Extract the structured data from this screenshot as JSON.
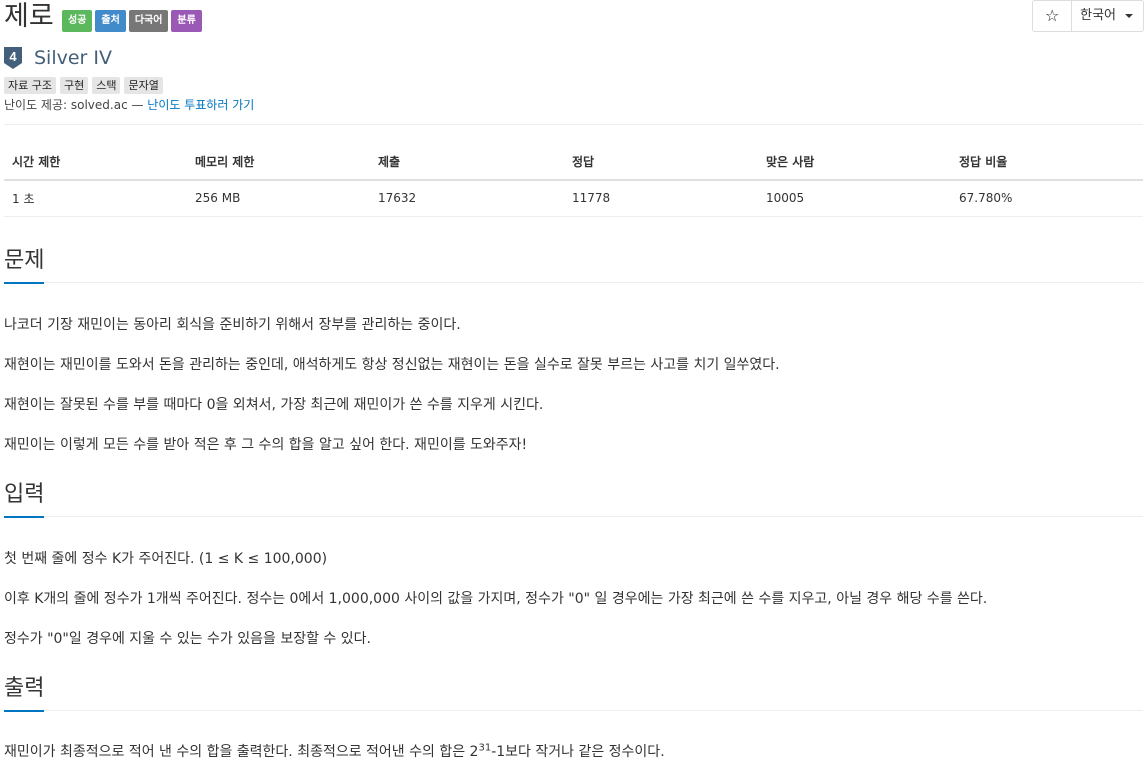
{
  "problem": {
    "title": "제로",
    "badges": [
      {
        "label": "성공",
        "color": "#5cb85c"
      },
      {
        "label": "출처",
        "color": "#428bca"
      },
      {
        "label": "다국어",
        "color": "#777777"
      },
      {
        "label": "분류",
        "color": "#9b59b6"
      }
    ],
    "tier_number": "4",
    "tier_label": "Silver IV",
    "tags": [
      "자료 구조",
      "구현",
      "스택",
      "문자열"
    ],
    "difficulty_prefix": "난이도 제공: solved.ac — ",
    "difficulty_link": "난이도 투표하러 가기"
  },
  "toolbar": {
    "star_label": "☆",
    "language_label": "한국어"
  },
  "stats": {
    "headers": [
      "시간 제한",
      "메모리 제한",
      "제출",
      "정답",
      "맞은 사람",
      "정답 비율"
    ],
    "values": [
      "1 초",
      "256 MB",
      "17632",
      "11778",
      "10005",
      "67.780%"
    ]
  },
  "sections": {
    "problem_title": "문제",
    "problem_paragraphs": [
      "나코더 기장 재민이는 동아리 회식을 준비하기 위해서 장부를 관리하는 중이다.",
      "재현이는 재민이를 도와서 돈을 관리하는 중인데, 애석하게도 항상 정신없는 재현이는 돈을 실수로 잘못 부르는 사고를 치기 일쑤였다.",
      "재현이는 잘못된 수를 부를 때마다 0을 외쳐서, 가장 최근에 재민이가 쓴 수를 지우게 시킨다.",
      "재민이는 이렇게 모든 수를 받아 적은 후 그 수의 합을 알고 싶어 한다. 재민이를 도와주자!"
    ],
    "input_title": "입력",
    "input_paragraphs": [
      "첫 번째 줄에 정수 K가 주어진다. (1 ≤ K ≤ 100,000)",
      "이후 K개의 줄에 정수가 1개씩 주어진다. 정수는 0에서 1,000,000 사이의 값을 가지며, 정수가 \"0\" 일 경우에는 가장 최근에 쓴 수를 지우고, 아닐 경우 해당 수를 쓴다.",
      "정수가 \"0\"일 경우에 지울 수 있는 수가 있음을 보장할 수 있다."
    ],
    "output_title": "출력",
    "output_before": "재민이가 최종적으로 적어 낸 수의 합을 출력한다. 최종적으로 적어낸 수의 합은 2",
    "output_sup": "31",
    "output_after": "-1보다 작거나 같은 정수이다."
  }
}
